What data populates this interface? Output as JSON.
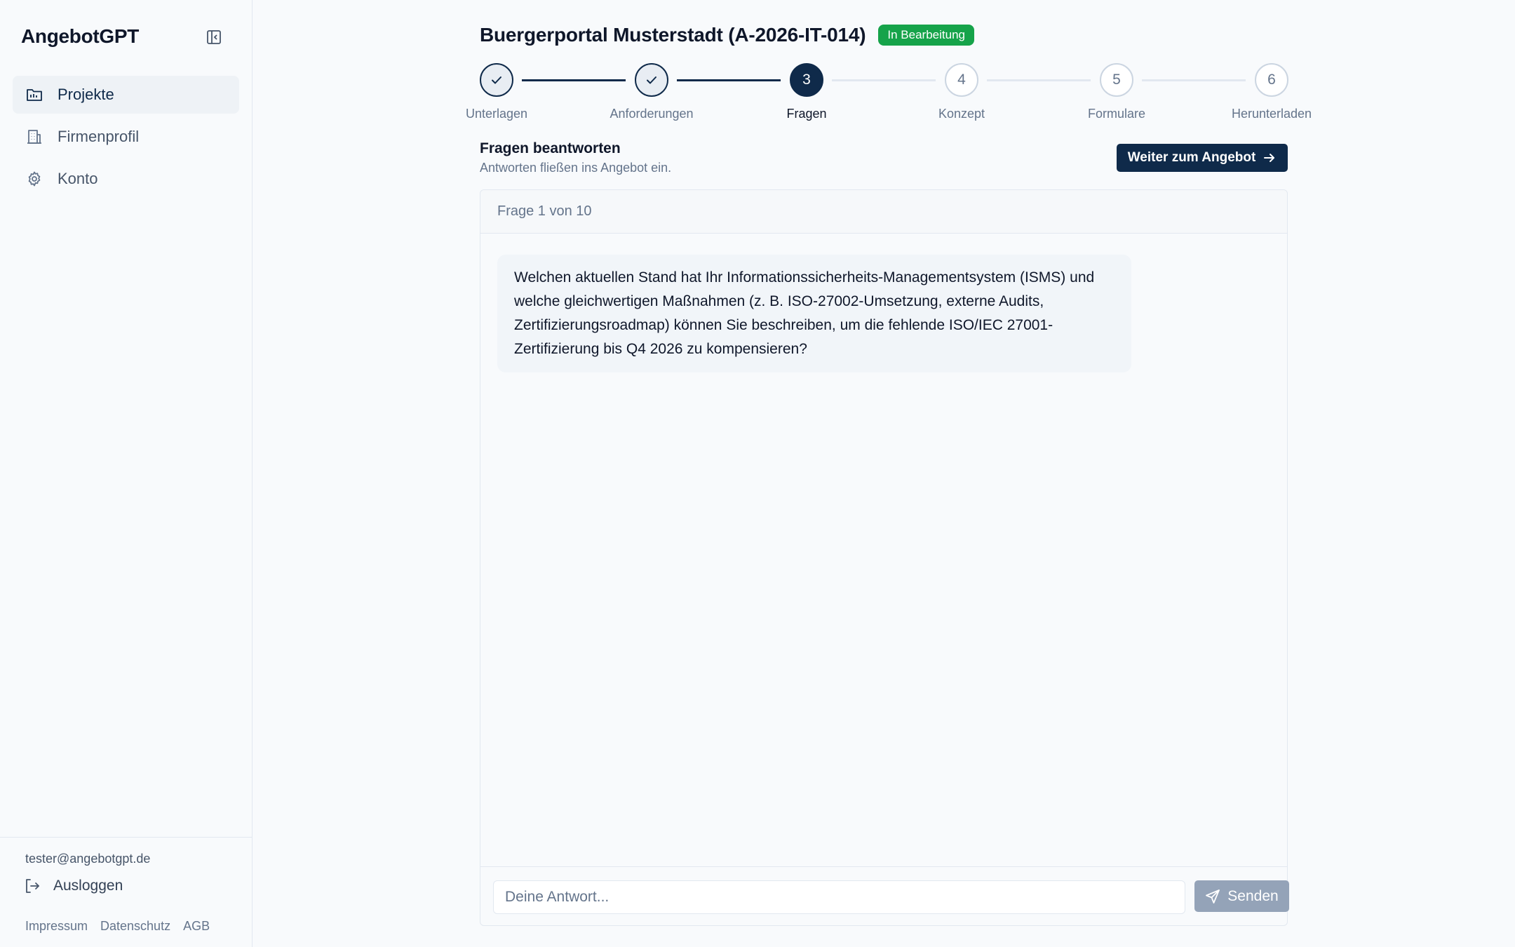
{
  "sidebar": {
    "brand": "AngebotGPT",
    "nav": [
      {
        "label": "Projekte",
        "icon": "folder-icon",
        "active": true
      },
      {
        "label": "Firmenprofil",
        "icon": "building-icon",
        "active": false
      },
      {
        "label": "Konto",
        "icon": "gear-icon",
        "active": false
      }
    ],
    "user_email": "tester@angebotgpt.de",
    "logout_label": "Ausloggen",
    "footer_links": [
      "Impressum",
      "Datenschutz",
      "AGB"
    ]
  },
  "header": {
    "title": "Buergerportal Musterstadt (A-2026-IT-014)",
    "status": "In Bearbeitung"
  },
  "stepper": {
    "current": 3,
    "steps": [
      {
        "number": "1",
        "label": "Unterlagen",
        "state": "done"
      },
      {
        "number": "2",
        "label": "Anforderungen",
        "state": "done"
      },
      {
        "number": "3",
        "label": "Fragen",
        "state": "current"
      },
      {
        "number": "4",
        "label": "Konzept",
        "state": "pending"
      },
      {
        "number": "5",
        "label": "Formulare",
        "state": "pending"
      },
      {
        "number": "6",
        "label": "Herunterladen",
        "state": "pending"
      }
    ]
  },
  "section": {
    "title": "Fragen beantworten",
    "subtitle": "Antworten fließen ins Angebot ein.",
    "next_label": "Weiter zum Angebot"
  },
  "card": {
    "progress": "Frage 1 von 10",
    "question": "Welchen aktuellen Stand hat Ihr Informationssicherheits-Managementsystem (ISMS) und welche gleichwertigen Maßnahmen (z. B. ISO-27002-Umsetzung, externe Audits, Zertifizierungsroadmap) können Sie beschreiben, um die fehlende ISO/IEC 27001-Zertifizierung bis Q4 2026 zu kompensieren?",
    "answer_value": "",
    "answer_placeholder": "Deine Antwort...",
    "send_label": "Senden"
  },
  "colors": {
    "primary": "#0f2a4a",
    "success": "#16a34a",
    "disabled": "#94a3b8",
    "border": "#e2e8f0"
  }
}
